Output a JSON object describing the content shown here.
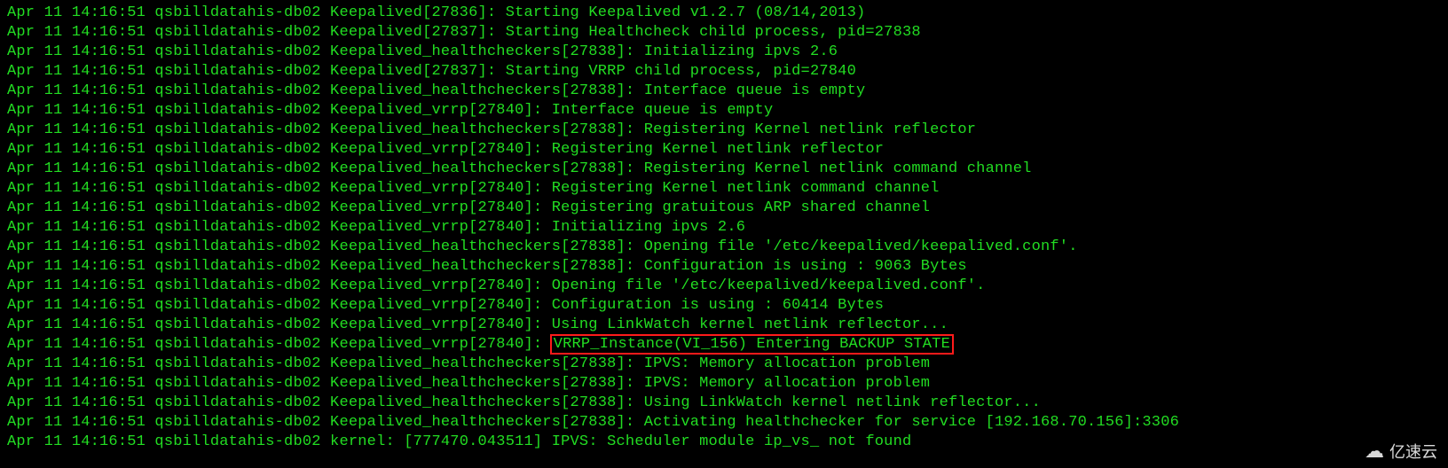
{
  "watermark": "亿速云",
  "logs": [
    {
      "ts": "Apr 11 14:16:51",
      "host": "qsbilldatahis-db02",
      "proc": "Keepalived",
      "pid": "27836",
      "msg": "Starting Keepalived v1.2.7 (08/14,2013)",
      "highlight": false
    },
    {
      "ts": "Apr 11 14:16:51",
      "host": "qsbilldatahis-db02",
      "proc": "Keepalived",
      "pid": "27837",
      "msg": "Starting Healthcheck child process, pid=27838",
      "highlight": false
    },
    {
      "ts": "Apr 11 14:16:51",
      "host": "qsbilldatahis-db02",
      "proc": "Keepalived_healthcheckers",
      "pid": "27838",
      "msg": "Initializing ipvs 2.6",
      "highlight": false
    },
    {
      "ts": "Apr 11 14:16:51",
      "host": "qsbilldatahis-db02",
      "proc": "Keepalived",
      "pid": "27837",
      "msg": "Starting VRRP child process, pid=27840",
      "highlight": false
    },
    {
      "ts": "Apr 11 14:16:51",
      "host": "qsbilldatahis-db02",
      "proc": "Keepalived_healthcheckers",
      "pid": "27838",
      "msg": "Interface queue is empty",
      "highlight": false
    },
    {
      "ts": "Apr 11 14:16:51",
      "host": "qsbilldatahis-db02",
      "proc": "Keepalived_vrrp",
      "pid": "27840",
      "msg": "Interface queue is empty",
      "highlight": false
    },
    {
      "ts": "Apr 11 14:16:51",
      "host": "qsbilldatahis-db02",
      "proc": "Keepalived_healthcheckers",
      "pid": "27838",
      "msg": "Registering Kernel netlink reflector",
      "highlight": false
    },
    {
      "ts": "Apr 11 14:16:51",
      "host": "qsbilldatahis-db02",
      "proc": "Keepalived_vrrp",
      "pid": "27840",
      "msg": "Registering Kernel netlink reflector",
      "highlight": false
    },
    {
      "ts": "Apr 11 14:16:51",
      "host": "qsbilldatahis-db02",
      "proc": "Keepalived_healthcheckers",
      "pid": "27838",
      "msg": "Registering Kernel netlink command channel",
      "highlight": false
    },
    {
      "ts": "Apr 11 14:16:51",
      "host": "qsbilldatahis-db02",
      "proc": "Keepalived_vrrp",
      "pid": "27840",
      "msg": "Registering Kernel netlink command channel",
      "highlight": false
    },
    {
      "ts": "Apr 11 14:16:51",
      "host": "qsbilldatahis-db02",
      "proc": "Keepalived_vrrp",
      "pid": "27840",
      "msg": "Registering gratuitous ARP shared channel",
      "highlight": false
    },
    {
      "ts": "Apr 11 14:16:51",
      "host": "qsbilldatahis-db02",
      "proc": "Keepalived_vrrp",
      "pid": "27840",
      "msg": "Initializing ipvs 2.6",
      "highlight": false
    },
    {
      "ts": "Apr 11 14:16:51",
      "host": "qsbilldatahis-db02",
      "proc": "Keepalived_healthcheckers",
      "pid": "27838",
      "msg": "Opening file '/etc/keepalived/keepalived.conf'.",
      "highlight": false
    },
    {
      "ts": "Apr 11 14:16:51",
      "host": "qsbilldatahis-db02",
      "proc": "Keepalived_healthcheckers",
      "pid": "27838",
      "msg": "Configuration is using : 9063 Bytes",
      "highlight": false
    },
    {
      "ts": "Apr 11 14:16:51",
      "host": "qsbilldatahis-db02",
      "proc": "Keepalived_vrrp",
      "pid": "27840",
      "msg": "Opening file '/etc/keepalived/keepalived.conf'.",
      "highlight": false
    },
    {
      "ts": "Apr 11 14:16:51",
      "host": "qsbilldatahis-db02",
      "proc": "Keepalived_vrrp",
      "pid": "27840",
      "msg": "Configuration is using : 60414 Bytes",
      "highlight": false
    },
    {
      "ts": "Apr 11 14:16:51",
      "host": "qsbilldatahis-db02",
      "proc": "Keepalived_vrrp",
      "pid": "27840",
      "msg": "Using LinkWatch kernel netlink reflector...",
      "highlight": false
    },
    {
      "ts": "Apr 11 14:16:51",
      "host": "qsbilldatahis-db02",
      "proc": "Keepalived_vrrp",
      "pid": "27840",
      "msg": "VRRP_Instance(VI_156) Entering BACKUP STATE",
      "highlight": true
    },
    {
      "ts": "Apr 11 14:16:51",
      "host": "qsbilldatahis-db02",
      "proc": "Keepalived_healthcheckers",
      "pid": "27838",
      "msg": "IPVS: Memory allocation problem",
      "highlight": false
    },
    {
      "ts": "Apr 11 14:16:51",
      "host": "qsbilldatahis-db02",
      "proc": "Keepalived_healthcheckers",
      "pid": "27838",
      "msg": "IPVS: Memory allocation problem",
      "highlight": false
    },
    {
      "ts": "Apr 11 14:16:51",
      "host": "qsbilldatahis-db02",
      "proc": "Keepalived_healthcheckers",
      "pid": "27838",
      "msg": "Using LinkWatch kernel netlink reflector...",
      "highlight": false
    },
    {
      "ts": "Apr 11 14:16:51",
      "host": "qsbilldatahis-db02",
      "proc": "Keepalived_healthcheckers",
      "pid": "27838",
      "msg": "Activating healthchecker for service [192.168.70.156]:3306",
      "highlight": false
    },
    {
      "ts": "Apr 11 14:16:51",
      "host": "qsbilldatahis-db02",
      "proc": "kernel",
      "pid": "",
      "msg": "[777470.043511] IPVS: Scheduler module ip_vs_ not found",
      "highlight": false
    }
  ]
}
